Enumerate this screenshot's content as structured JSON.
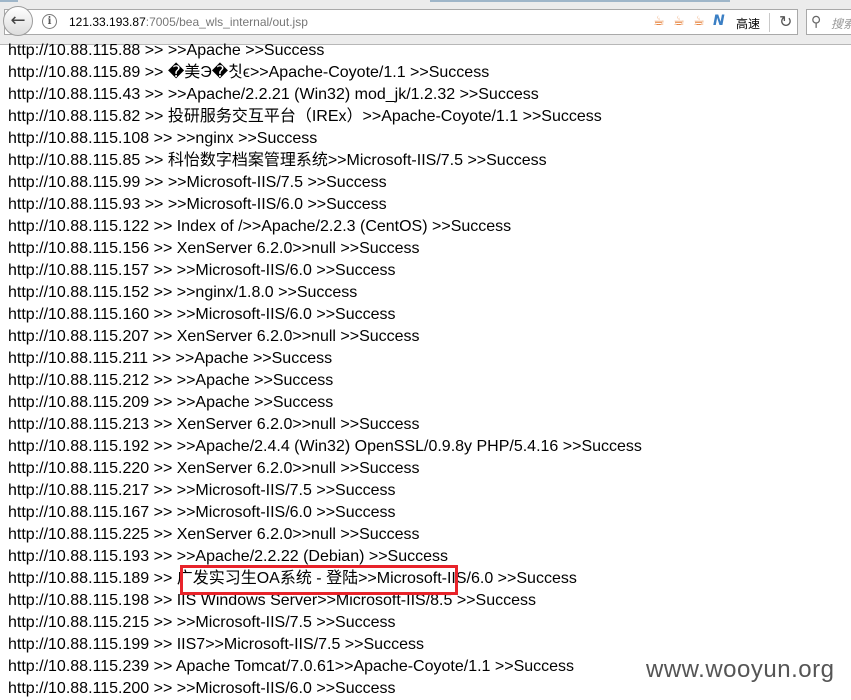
{
  "browser": {
    "url_host": "121.33.193.87",
    "url_rest": ":7005/bea_wls_internal/out.jsp",
    "speed_label": "高速",
    "search_placeholder": "搜索"
  },
  "lines": [
    "http://10.88.115.88 >> >>Apache >>Success",
    "http://10.88.115.89 >> �美Э�칫ϵ>>Apache-Coyote/1.1 >>Success",
    "http://10.88.115.43 >> >>Apache/2.2.21 (Win32) mod_jk/1.2.32 >>Success",
    "http://10.88.115.82 >> 投研服务交互平台（IREx）>>Apache-Coyote/1.1 >>Success",
    "http://10.88.115.108 >> >>nginx >>Success",
    "http://10.88.115.85 >> 科怡数字档案管理系统>>Microsoft-IIS/7.5 >>Success",
    "http://10.88.115.99 >> >>Microsoft-IIS/7.5 >>Success",
    "http://10.88.115.93 >> >>Microsoft-IIS/6.0 >>Success",
    "http://10.88.115.122 >> Index of />>Apache/2.2.3 (CentOS) >>Success",
    "http://10.88.115.156 >> XenServer 6.2.0>>null >>Success",
    "http://10.88.115.157 >> >>Microsoft-IIS/6.0 >>Success",
    "http://10.88.115.152 >> >>nginx/1.8.0 >>Success",
    "http://10.88.115.160 >> >>Microsoft-IIS/6.0 >>Success",
    "http://10.88.115.207 >> XenServer 6.2.0>>null >>Success",
    "http://10.88.115.211 >> >>Apache >>Success",
    "http://10.88.115.212 >> >>Apache >>Success",
    "http://10.88.115.209 >> >>Apache >>Success",
    "http://10.88.115.213 >> XenServer 6.2.0>>null >>Success",
    "http://10.88.115.192 >> >>Apache/2.4.4 (Win32) OpenSSL/0.9.8y PHP/5.4.16 >>Success",
    "http://10.88.115.220 >> XenServer 6.2.0>>null >>Success",
    "http://10.88.115.217 >> >>Microsoft-IIS/7.5 >>Success",
    "http://10.88.115.167 >> >>Microsoft-IIS/6.0 >>Success",
    "http://10.88.115.225 >> XenServer 6.2.0>>null >>Success",
    "http://10.88.115.193 >> >>Apache/2.2.22 (Debian) >>Success",
    "http://10.88.115.189 >> 广发实习生OA系统 - 登陆>>Microsoft-IIS/6.0 >>Success",
    "http://10.88.115.198 >> IIS Windows Server>>Microsoft-IIS/8.5 >>Success",
    "http://10.88.115.215 >> >>Microsoft-IIS/7.5 >>Success",
    "http://10.88.115.199 >> IIS7>>Microsoft-IIS/7.5 >>Success",
    "http://10.88.115.239 >> Apache Tomcat/7.0.61>>Apache-Coyote/1.1 >>Success",
    "http://10.88.115.200 >> >>Microsoft-IIS/6.0 >>Success"
  ],
  "watermark": "www.wooyun.org",
  "colors": {
    "highlight": "#e8232a"
  }
}
